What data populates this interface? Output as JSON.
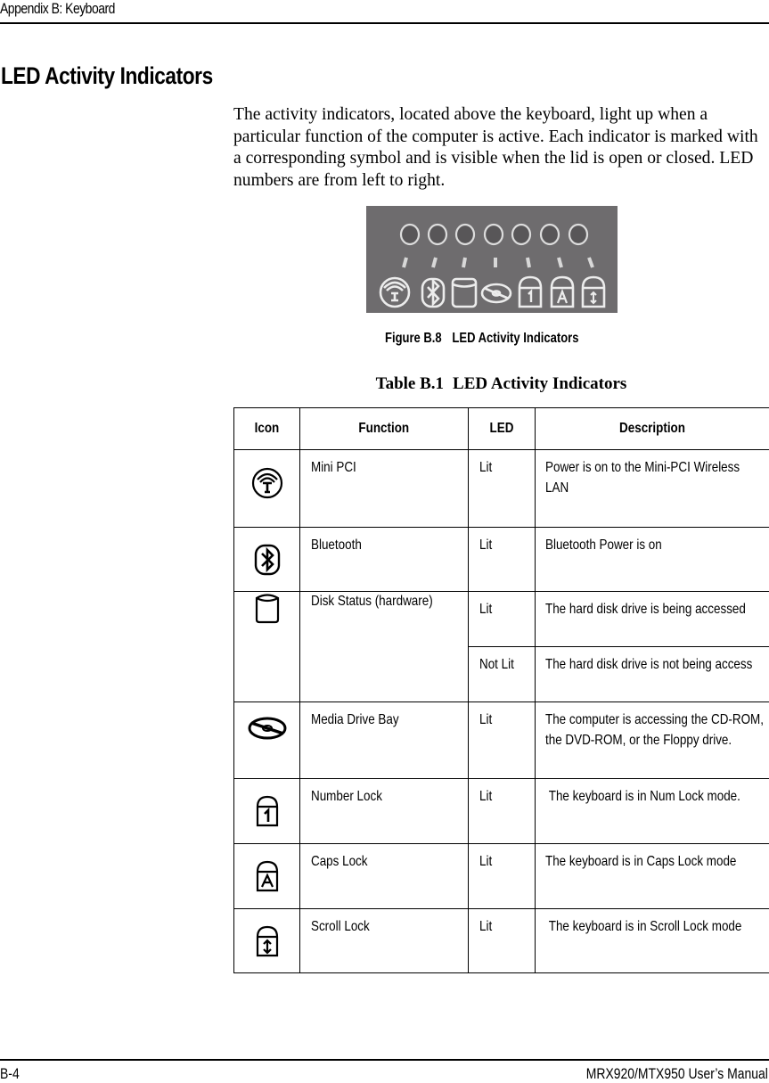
{
  "header": {
    "running_head": "Appendix B: Keyboard"
  },
  "section": {
    "title": "LED Activity Indicators",
    "intro": "The activity indicators, located above the keyboard, light up when a particular function of the computer is active. Each indicator is marked with a corresponding symbol and is visible when the lid is open or closed. LED numbers are from left to right."
  },
  "figure": {
    "label": "Figure B.8",
    "caption": "LED Activity Indicators",
    "panel_color": "#6e6c6e",
    "symbol_color": "#ececec",
    "indicators": [
      "wireless-lan-icon",
      "bluetooth-icon",
      "disk-icon",
      "media-drive-icon",
      "num-lock-icon",
      "caps-lock-icon",
      "scroll-lock-icon"
    ]
  },
  "table": {
    "label": "Table B.1",
    "title": "LED Activity Indicators",
    "headers": [
      "Icon",
      "Function",
      "LED",
      "Description"
    ],
    "rows": [
      {
        "icon": "wireless-lan-icon",
        "function": "Mini PCI",
        "states": [
          {
            "led": "Lit",
            "description": "Power is on to the Mini-PCI Wireless LAN"
          }
        ]
      },
      {
        "icon": "bluetooth-icon",
        "function": "Bluetooth",
        "states": [
          {
            "led": "Lit",
            "description": "Bluetooth Power is on"
          }
        ]
      },
      {
        "icon": "disk-icon",
        "function": "Disk Status (hardware)",
        "states": [
          {
            "led": "Lit",
            "description": "The hard disk drive is being accessed"
          },
          {
            "led": "Not Lit",
            "description": "The hard disk drive is not being access"
          }
        ]
      },
      {
        "icon": "media-drive-icon",
        "function": "Media Drive Bay",
        "states": [
          {
            "led": "Lit",
            "description": "The computer is accessing the CD-ROM, the DVD-ROM, or the Floppy drive."
          }
        ]
      },
      {
        "icon": "num-lock-icon",
        "function": "Number Lock",
        "states": [
          {
            "led": "Lit",
            "description": " The keyboard is in Num Lock mode."
          }
        ]
      },
      {
        "icon": "caps-lock-icon",
        "function": "Caps Lock",
        "states": [
          {
            "led": "Lit",
            "description": "The keyboard is in Caps Lock mode"
          }
        ]
      },
      {
        "icon": "scroll-lock-icon",
        "function": "Scroll Lock",
        "states": [
          {
            "led": "Lit",
            "description": " The keyboard is in Scroll Lock mode"
          }
        ]
      }
    ]
  },
  "footer": {
    "page_number": "B-4",
    "manual_title": "MRX920/MTX950 User’s Manual"
  }
}
